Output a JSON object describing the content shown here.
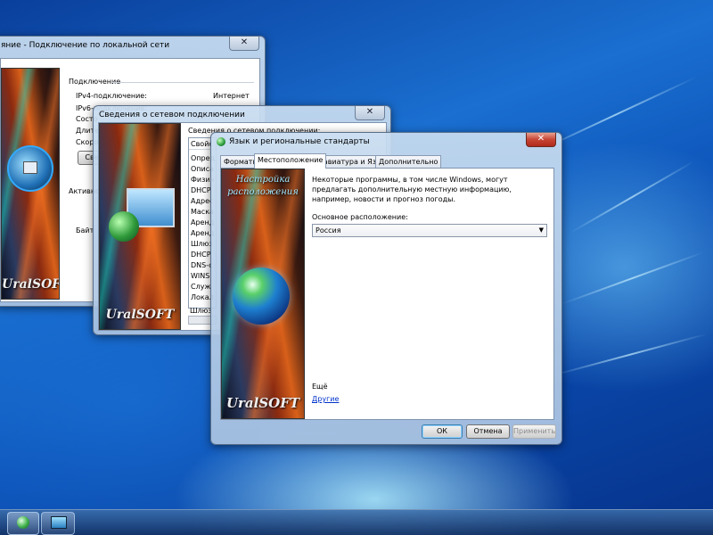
{
  "window_lan": {
    "title": "яние - Подключение по локальной сети",
    "section_connection": "Подключение",
    "rows": [
      {
        "label": "IPv4-подключение:",
        "value": "Интернет"
      },
      {
        "label": "IPv6-подключение:",
        "value": ""
      },
      {
        "label": "Состо",
        "value": ""
      },
      {
        "label": "Длите",
        "value": ""
      },
      {
        "label": "Скоро",
        "value": ""
      }
    ],
    "details_btn": "Све",
    "activity_label": "Активно",
    "bytes_label": "Байт",
    "brand": "UralSOFT"
  },
  "window_details": {
    "title": "Сведения о сетевом подключении",
    "header": "Сведения о сетевом подключении:",
    "col_property": "Свойс",
    "props": [
      "Опред",
      "Описа",
      "Физич",
      "DHCP",
      "Адрес",
      "Маска",
      "Аренд",
      "Аренд",
      "Шлюз",
      "DHCP",
      "DNS-с",
      "WINS",
      "Служ",
      "Локал",
      "Шлюз"
    ],
    "brand": "UralSOFT"
  },
  "window_region": {
    "title": "Язык и региональные стандарты",
    "tabs": [
      "Форматы",
      "Местоположение",
      "Клавиатура и Язык",
      "Дополнительно"
    ],
    "active_tab": 1,
    "art_caption_line1": "Настройка",
    "art_caption_line2": "расположения",
    "brand": "UralSOFT",
    "description": "Некоторые программы, в том числе Windows, могут предлагать дополнительную местную информацию, например, новости и прогноз погоды.",
    "location_label": "Основное расположение:",
    "location_value": "Россия",
    "more_label": "Ещё",
    "other_link": "Другие",
    "ok": "ОК",
    "cancel": "Отмена",
    "apply": "Применить"
  },
  "colors": {
    "accent_link": "#0033cc",
    "close_red": "#c74535"
  }
}
